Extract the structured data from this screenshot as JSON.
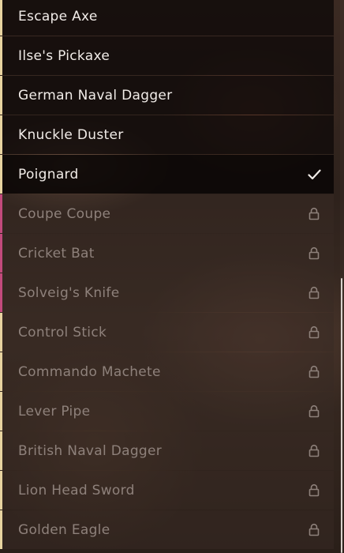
{
  "items": [
    {
      "label": "Escape Axe",
      "status": "unlocked",
      "accent": "#e7d3a0"
    },
    {
      "label": "Ilse's Pickaxe",
      "status": "unlocked",
      "accent": "#e7d3a0"
    },
    {
      "label": "German Naval Dagger",
      "status": "unlocked",
      "accent": "#e7d3a0"
    },
    {
      "label": "Knuckle Duster",
      "status": "unlocked",
      "accent": "#e7d3a0"
    },
    {
      "label": "Poignard",
      "status": "selected",
      "accent": "#e7d3a0",
      "icon": "checkmark-icon"
    },
    {
      "label": "Coupe Coupe",
      "status": "locked",
      "accent": "#c24a7c",
      "icon": "lock-icon"
    },
    {
      "label": "Cricket Bat",
      "status": "locked",
      "accent": "#c24a7c",
      "icon": "lock-icon"
    },
    {
      "label": "Solveig's Knife",
      "status": "locked",
      "accent": "#c24a7c",
      "icon": "lock-icon"
    },
    {
      "label": "Control Stick",
      "status": "locked",
      "accent": "#e7d3a0",
      "icon": "lock-icon"
    },
    {
      "label": "Commando Machete",
      "status": "locked",
      "accent": "#e7d3a0",
      "icon": "lock-icon"
    },
    {
      "label": "Lever Pipe",
      "status": "locked",
      "accent": "#e7d3a0",
      "icon": "lock-icon"
    },
    {
      "label": "British Naval Dagger",
      "status": "locked",
      "accent": "#e7d3a0",
      "icon": "lock-icon"
    },
    {
      "label": "Lion Head Sword",
      "status": "locked",
      "accent": "#e7d3a0",
      "icon": "lock-icon"
    },
    {
      "label": "Golden Eagle",
      "status": "locked",
      "accent": "#e7d3a0",
      "icon": "lock-icon"
    }
  ],
  "colors": {
    "unlocked_text": "#f1ece8",
    "locked_text": "#8e817b",
    "scroll_thumb": "#d8d2cc"
  }
}
